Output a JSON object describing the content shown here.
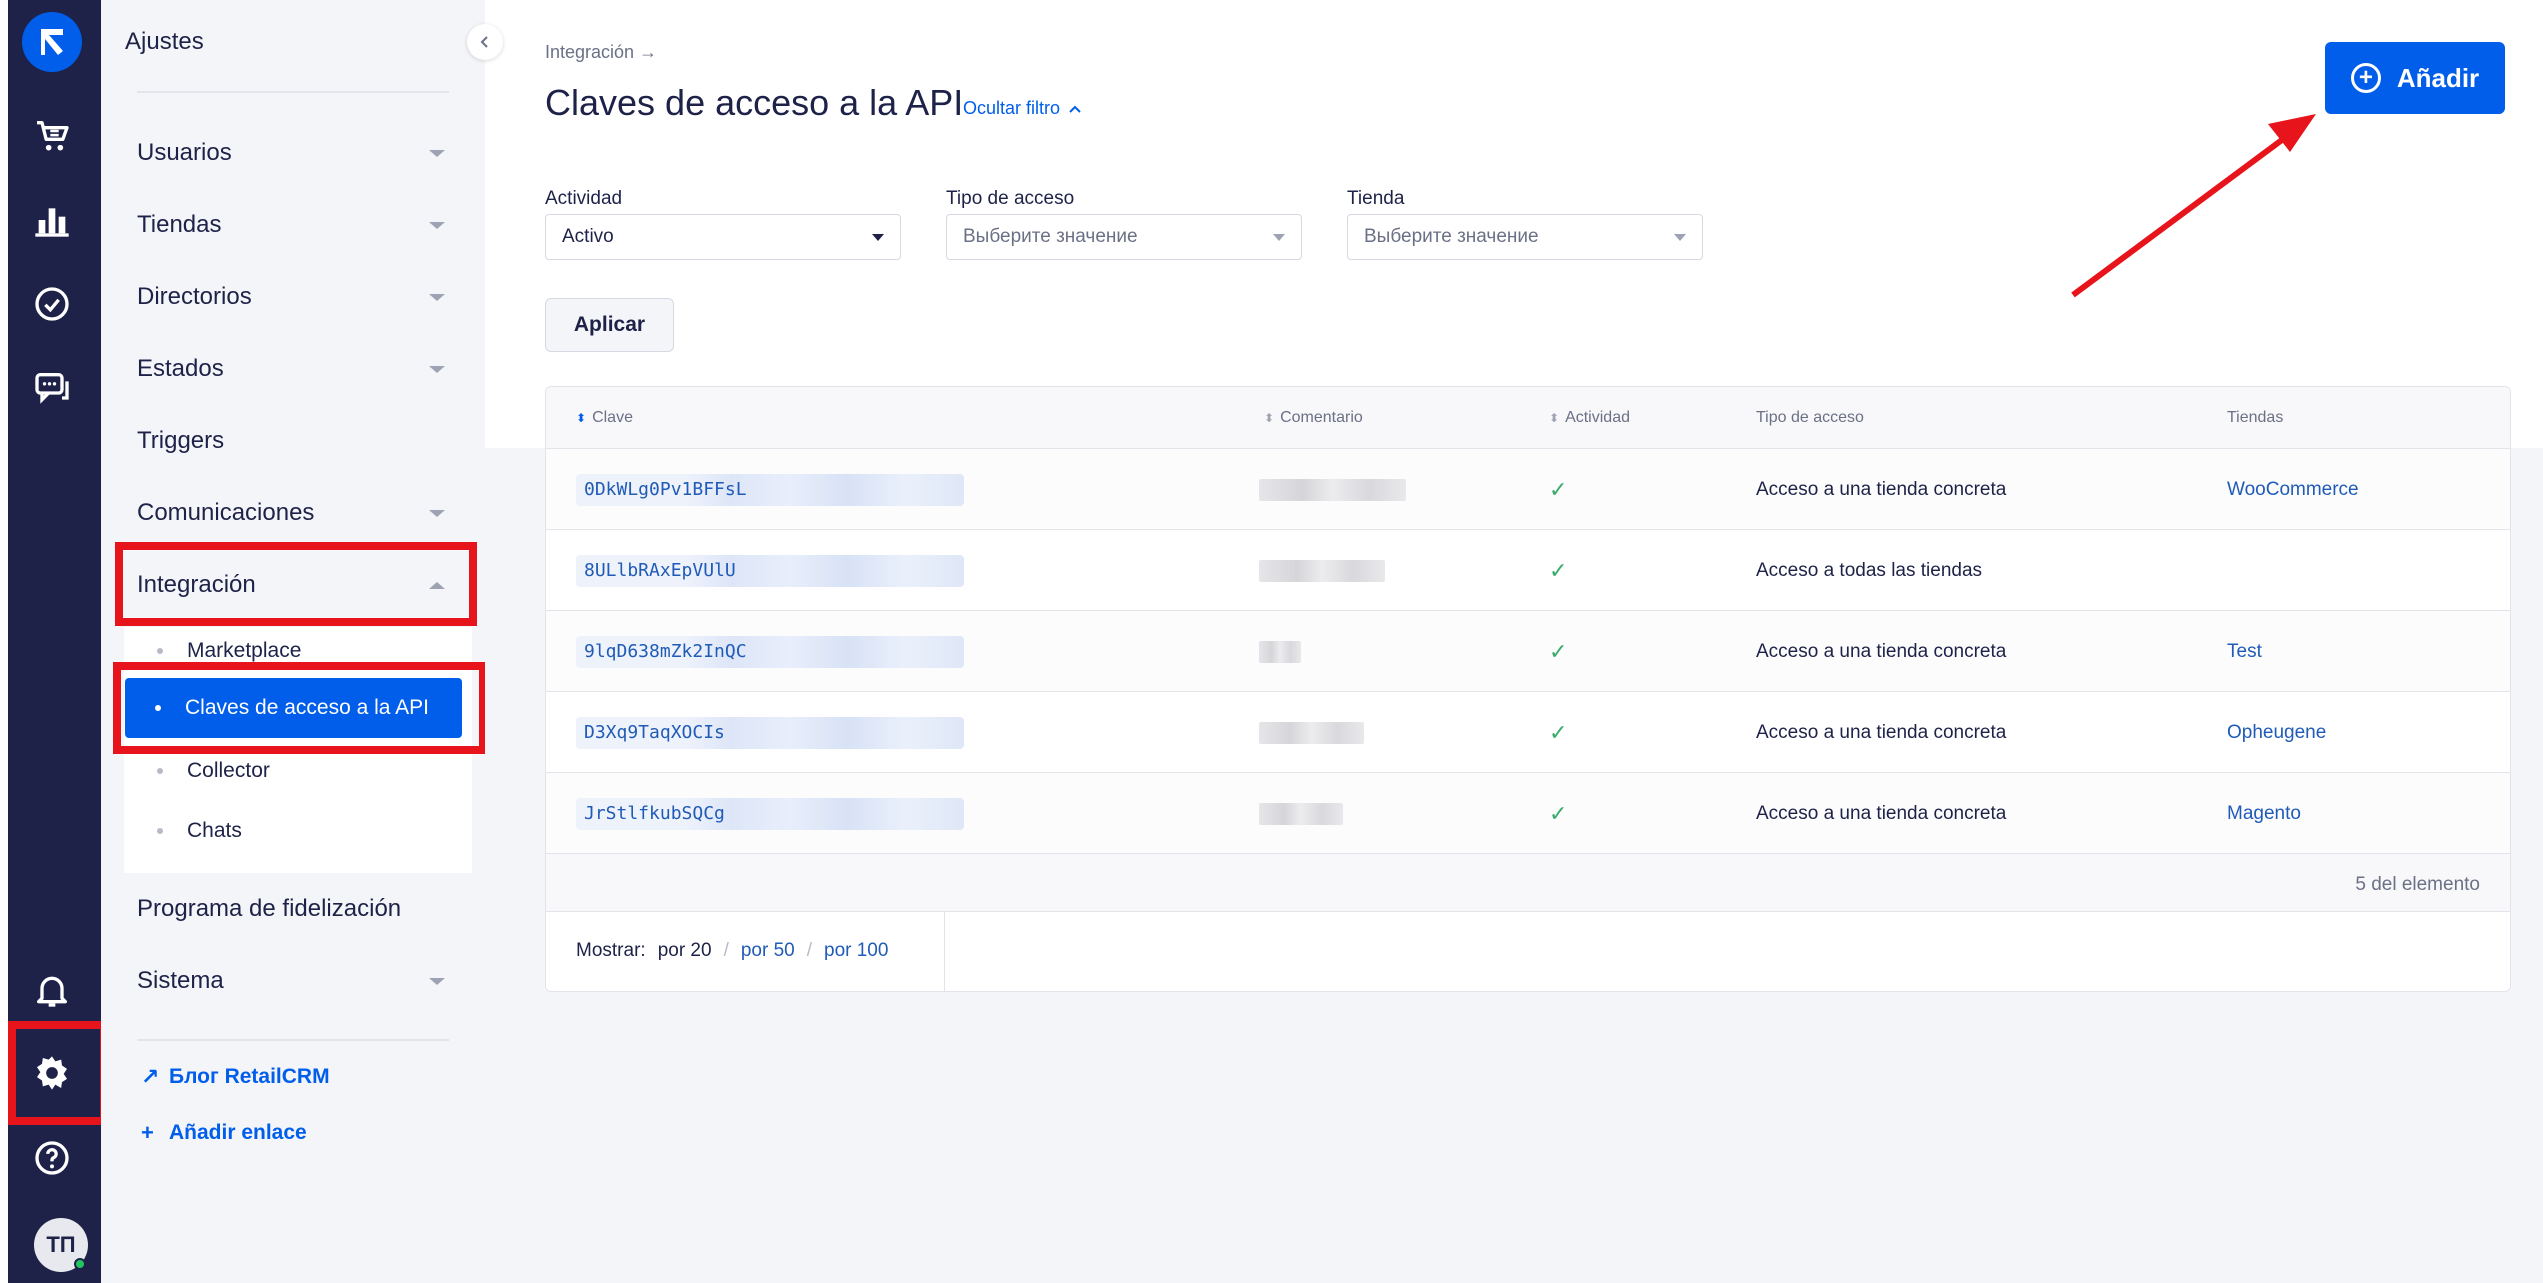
{
  "rail": {
    "logo_icon": "retailcrm-logo-icon",
    "avatar_initials": "ТП",
    "icons": [
      "cart-icon",
      "chart-icon",
      "check-circle-icon",
      "chat-icon",
      "bell-icon",
      "gear-icon",
      "help-icon"
    ]
  },
  "sidebar": {
    "title": "Ajustes",
    "items": [
      {
        "label": "Usuarios"
      },
      {
        "label": "Tiendas"
      },
      {
        "label": "Directorios"
      },
      {
        "label": "Estados"
      },
      {
        "label": "Triggers"
      },
      {
        "label": "Comunicaciones"
      },
      {
        "label": "Integración"
      },
      {
        "label": "Programa de fidelización"
      },
      {
        "label": "Sistema"
      }
    ],
    "subitems": [
      {
        "label": "Marketplace"
      },
      {
        "label": "Claves de acceso a la API"
      },
      {
        "label": "Collector"
      },
      {
        "label": "Chats"
      }
    ],
    "links": [
      {
        "label": "Блог RetailCRM"
      },
      {
        "label": "Añadir enlace"
      }
    ]
  },
  "main": {
    "breadcrumb": "Integración →",
    "title": "Claves de acceso a la API",
    "hide_filter": "Ocultar filtro",
    "add_button": "Añadir",
    "filters": [
      {
        "label": "Actividad",
        "value": "Activo"
      },
      {
        "label": "Tipo de acceso",
        "value": "Выберите значение"
      },
      {
        "label": "Tienda",
        "value": "Выберите значение"
      }
    ],
    "apply": "Aplicar",
    "table": {
      "headers": [
        "Clave",
        "Comentario",
        "Actividad",
        "Tipo de acceso",
        "Tiendas"
      ],
      "rows": [
        {
          "key": "0DkWLg0Pv1BFFsL",
          "access": "Acceso a una tienda concreta",
          "store": "WooCommerce"
        },
        {
          "key": "8ULlbRAxEpVUlU",
          "access": "Acceso a todas las tiendas",
          "store": ""
        },
        {
          "key": "9lqD638mZk2InQC",
          "access": "Acceso a una tienda concreta",
          "store": "Test"
        },
        {
          "key": "D3Xq9TaqXOCIs",
          "access": "Acceso a una tienda concreta",
          "store": "Opheugene"
        },
        {
          "key": "JrStlfkubSQCg",
          "access": "Acceso a una tienda concreta",
          "store": "Magento"
        }
      ],
      "count": "5 del elemento",
      "pager": {
        "label": "Mostrar:",
        "current": "por 20",
        "opt2": "por 50",
        "opt3": "por 100"
      }
    }
  }
}
